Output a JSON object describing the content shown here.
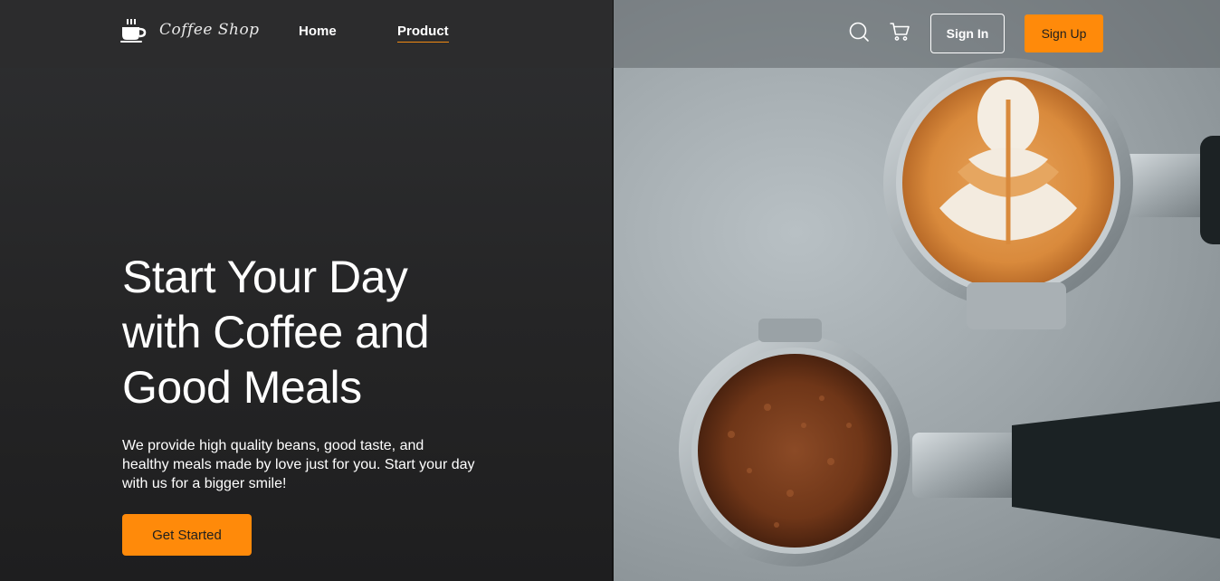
{
  "brand": {
    "name": "Coffee Shop",
    "icon": "coffee-cup-icon"
  },
  "nav": {
    "items": [
      {
        "label": "Home",
        "active": false
      },
      {
        "label": "Product",
        "active": true
      }
    ],
    "accent_color": "#ff8a0a"
  },
  "actions": {
    "search_icon": "search-icon",
    "cart_icon": "cart-icon",
    "sign_in": "Sign In",
    "sign_up": "Sign Up"
  },
  "hero": {
    "title_lines": [
      "Start Your Day",
      "with Coffee and",
      "Good Meals"
    ],
    "description_lines": [
      "We provide high quality beans, good taste, and",
      "healthy meals made by love just for you. Start your day",
      "with us for a bigger smile!"
    ],
    "cta": "Get Started"
  }
}
